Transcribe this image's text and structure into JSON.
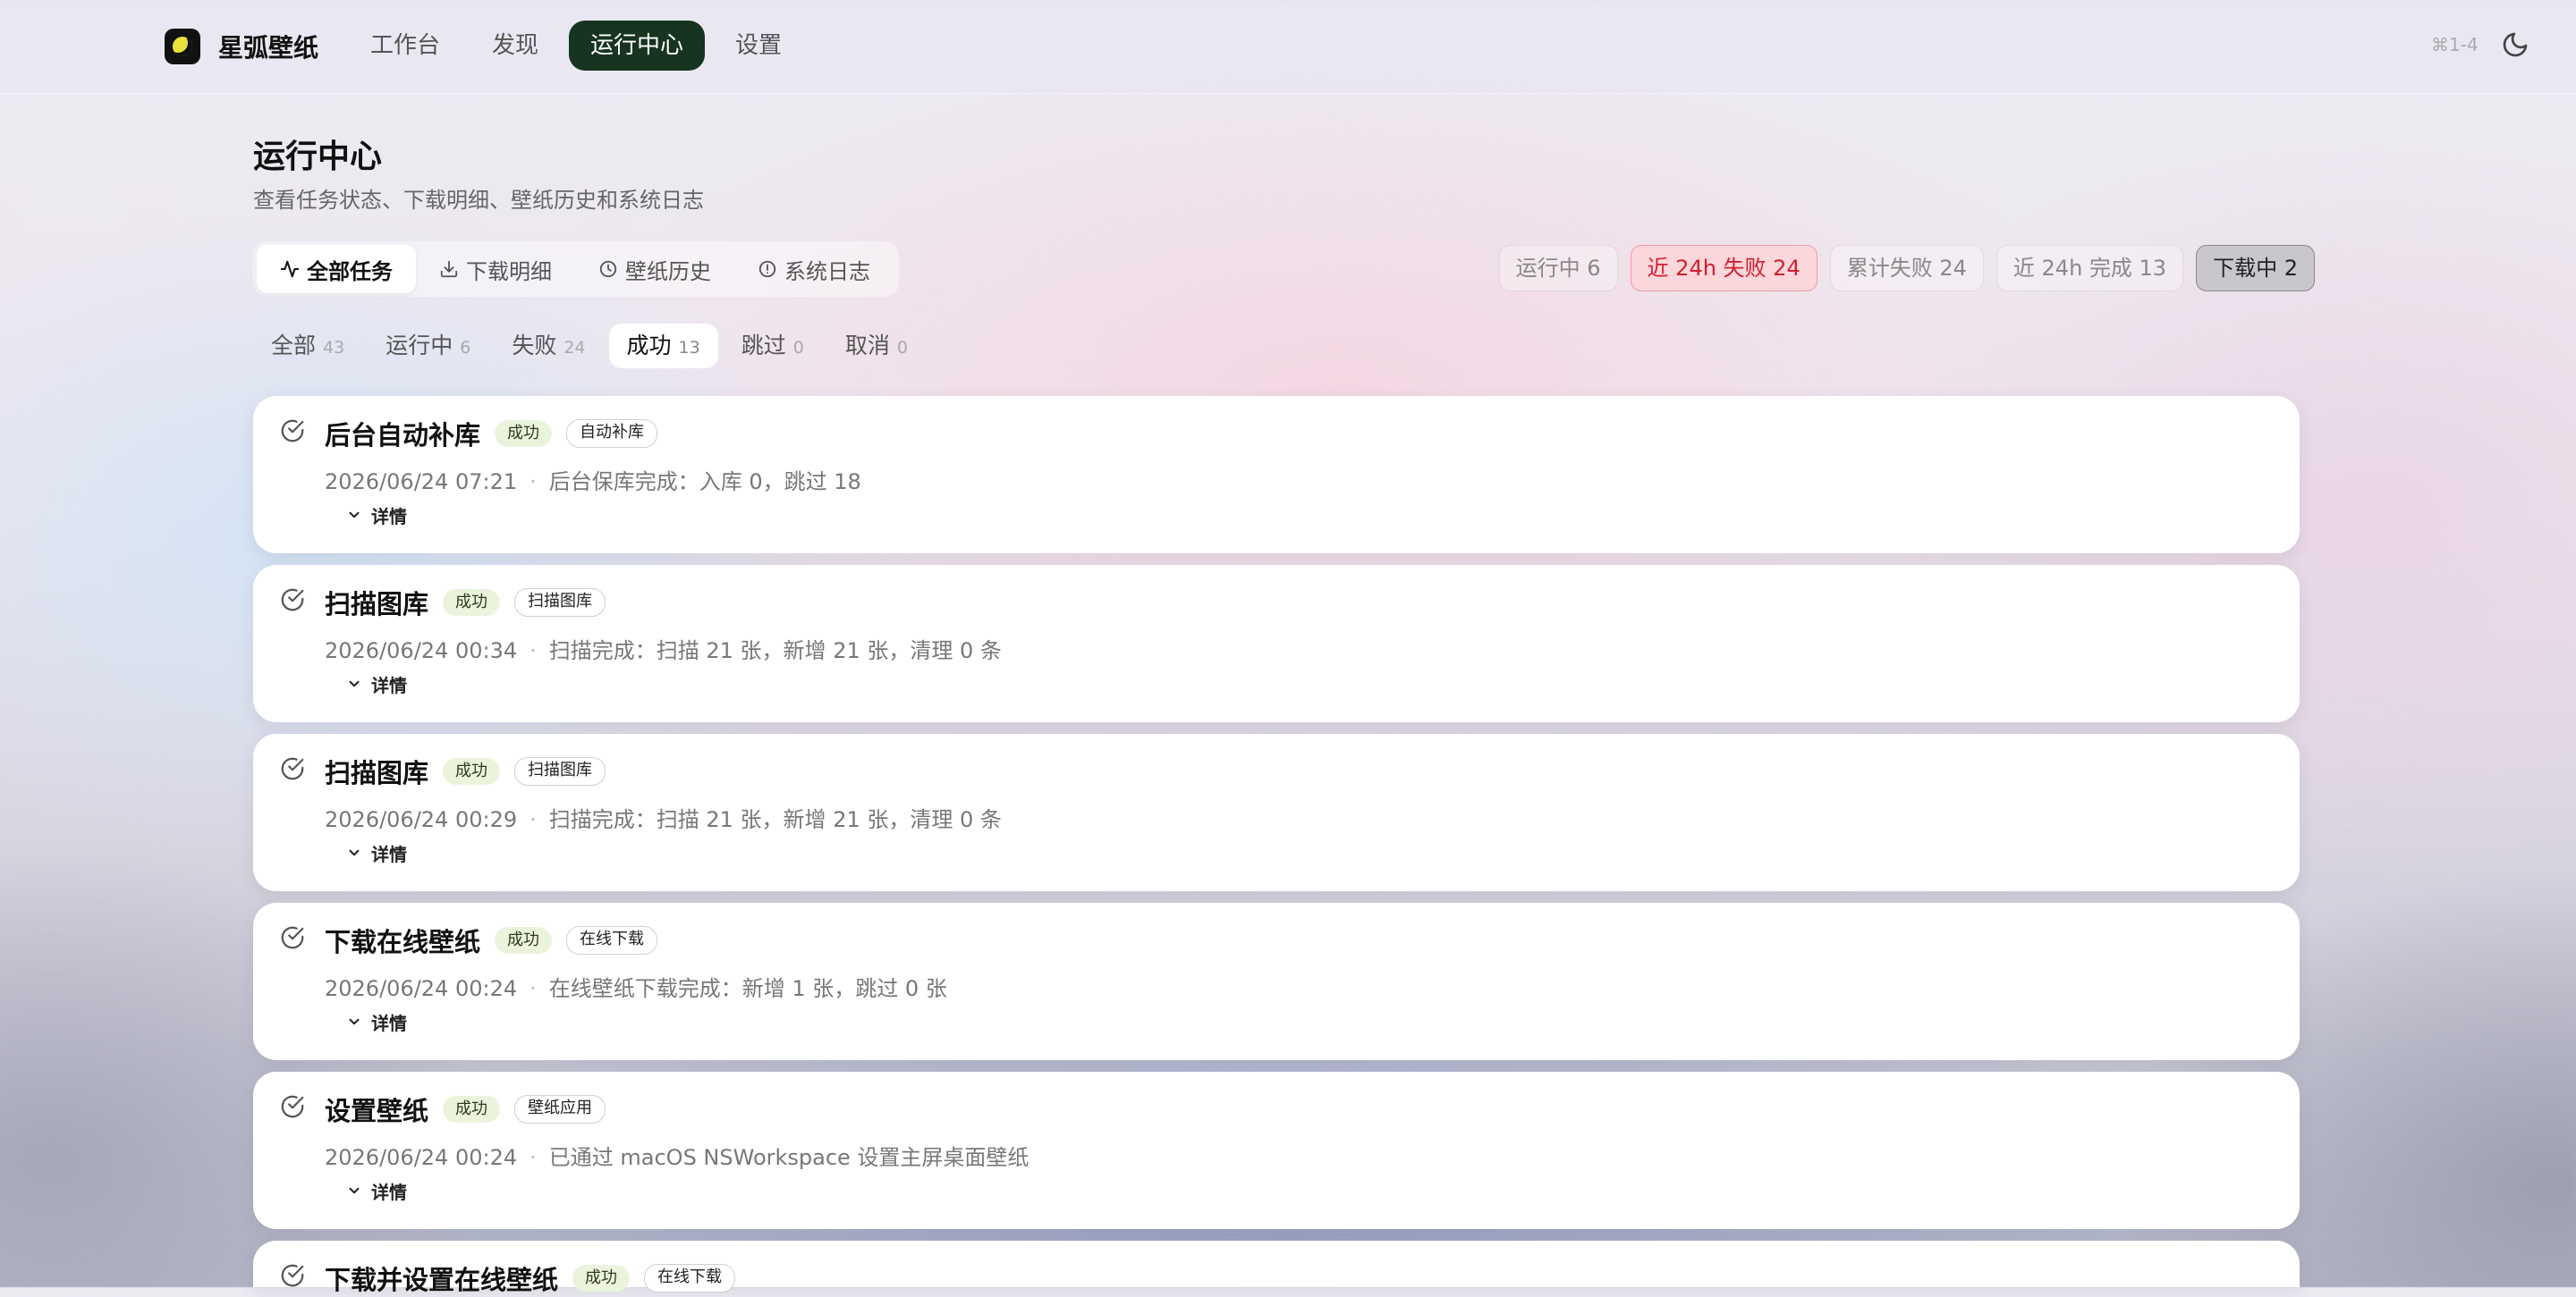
{
  "app": {
    "name": "星弧壁纸",
    "shortcut": "⌘1-4"
  },
  "nav": [
    {
      "label": "工作台",
      "active": false
    },
    {
      "label": "发现",
      "active": false
    },
    {
      "label": "运行中心",
      "active": true
    },
    {
      "label": "设置",
      "active": false
    }
  ],
  "page": {
    "title": "运行中心",
    "subtitle": "查看任务状态、下载明细、壁纸历史和系统日志"
  },
  "view_tabs": [
    {
      "label": "全部任务",
      "icon": "activity-icon",
      "active": true
    },
    {
      "label": "下载明细",
      "icon": "download-icon",
      "active": false
    },
    {
      "label": "壁纸历史",
      "icon": "clock-icon",
      "active": false
    },
    {
      "label": "系统日志",
      "icon": "info-icon",
      "active": false
    }
  ],
  "stats": [
    {
      "label": "运行中 6",
      "style": "normal"
    },
    {
      "label": "近 24h 失败 24",
      "style": "danger"
    },
    {
      "label": "累计失败 24",
      "style": "normal"
    },
    {
      "label": "近 24h 完成 13",
      "style": "normal"
    },
    {
      "label": "下载中 2",
      "style": "active"
    }
  ],
  "filters": [
    {
      "label": "全部",
      "count": "43",
      "active": false
    },
    {
      "label": "运行中",
      "count": "6",
      "active": false
    },
    {
      "label": "失败",
      "count": "24",
      "active": false
    },
    {
      "label": "成功",
      "count": "13",
      "active": true
    },
    {
      "label": "跳过",
      "count": "0",
      "active": false
    },
    {
      "label": "取消",
      "count": "0",
      "active": false
    }
  ],
  "detail_label": "详情",
  "tasks": [
    {
      "name": "后台自动补库",
      "status": "成功",
      "type": "自动补库",
      "time": "2026/06/24 07:21",
      "message": "后台保库完成：入库 0，跳过 18"
    },
    {
      "name": "扫描图库",
      "status": "成功",
      "type": "扫描图库",
      "time": "2026/06/24 00:34",
      "message": "扫描完成：扫描 21 张，新增 21 张，清理 0 条"
    },
    {
      "name": "扫描图库",
      "status": "成功",
      "type": "扫描图库",
      "time": "2026/06/24 00:29",
      "message": "扫描完成：扫描 21 张，新增 21 张，清理 0 条"
    },
    {
      "name": "下载在线壁纸",
      "status": "成功",
      "type": "在线下载",
      "time": "2026/06/24 00:24",
      "message": "在线壁纸下载完成：新增 1 张，跳过 0 张"
    },
    {
      "name": "设置壁纸",
      "status": "成功",
      "type": "壁纸应用",
      "time": "2026/06/24 00:24",
      "message": "已通过 macOS NSWorkspace 设置主屏桌面壁纸"
    },
    {
      "name": "下载并设置在线壁纸",
      "status": "成功",
      "type": "在线下载",
      "time": "",
      "message": ""
    }
  ],
  "colors": {
    "nav_active": "#163420",
    "danger": "#d02030",
    "success_tag": "#eaf4dc"
  }
}
